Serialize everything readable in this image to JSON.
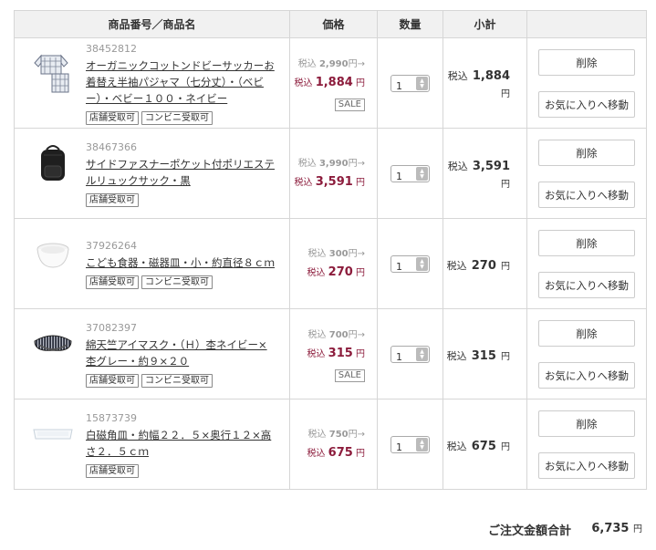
{
  "headers": {
    "product": "商品番号／商品名",
    "price": "価格",
    "qty": "数量",
    "subtotal": "小計"
  },
  "labels": {
    "tax_incl": "税込",
    "yen": "円",
    "arrow": "→",
    "sale": "SALE",
    "delete": "削除",
    "move_fav": "お気に入りへ移動"
  },
  "items": [
    {
      "id": "38452812",
      "name": "オーガニックコットンドビーサッカーお着替え半袖パジャマ（七分丈）・（ベビー）・ベビー１００・ネイビー",
      "tags": [
        "店舗受取可",
        "コンビニ受取可"
      ],
      "orig_price": "2,990",
      "price": "1,884",
      "sale": true,
      "qty": "1",
      "subtotal": "1,884",
      "icon": "pajama-icon"
    },
    {
      "id": "38467366",
      "name": "サイドファスナーポケット付ポリエステルリュックサック・黒",
      "tags": [
        "店舗受取可"
      ],
      "orig_price": "3,990",
      "price": "3,591",
      "sale": false,
      "qty": "1",
      "subtotal": "3,591",
      "icon": "backpack-icon"
    },
    {
      "id": "37926264",
      "name": "こども食器・磁器皿・小・約直径８ｃｍ",
      "tags": [
        "店舗受取可",
        "コンビニ受取可"
      ],
      "orig_price": "300",
      "price": "270",
      "sale": false,
      "qty": "1",
      "subtotal": "270",
      "icon": "bowl-icon"
    },
    {
      "id": "37082397",
      "name": "綿天竺アイマスク・（Ｈ）杢ネイビー×杢グレー・約９×２０",
      "tags": [
        "店舗受取可",
        "コンビニ受取可"
      ],
      "orig_price": "700",
      "price": "315",
      "sale": true,
      "qty": "1",
      "subtotal": "315",
      "icon": "eye-mask-icon"
    },
    {
      "id": "15873739",
      "name": "白磁角皿・約幅２２．５×奥行１２×高さ２．５ｃｍ",
      "tags": [
        "店舗受取可"
      ],
      "orig_price": "750",
      "price": "675",
      "sale": false,
      "qty": "1",
      "subtotal": "675",
      "icon": "plate-icon"
    }
  ],
  "total": {
    "label": "ご注文金額合計",
    "value": "6,735"
  }
}
